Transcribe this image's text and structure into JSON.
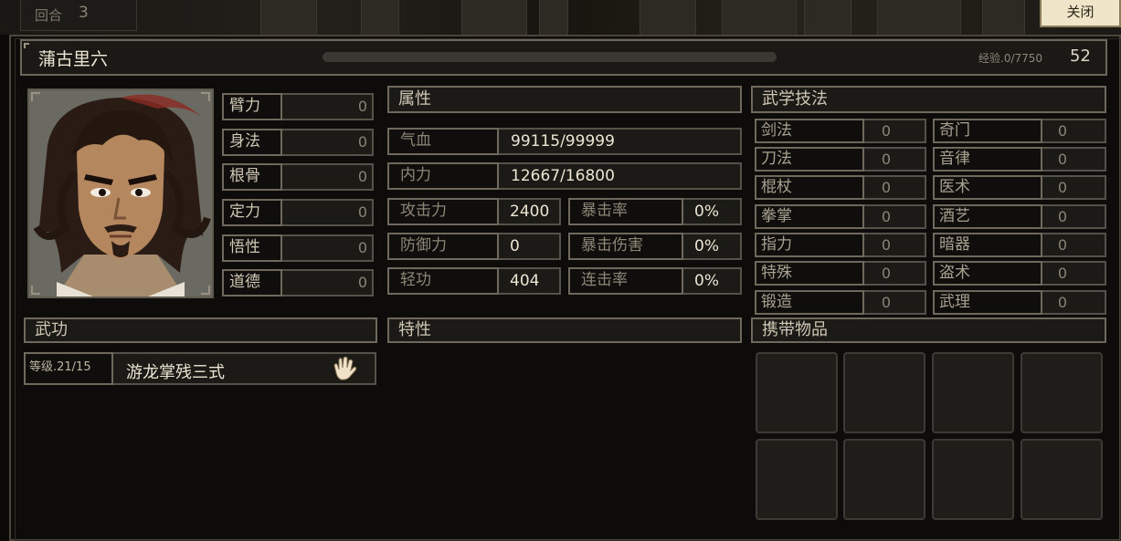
{
  "hud": {
    "round_label": "回合",
    "round_value": "3",
    "close_label": "关闭"
  },
  "character": {
    "name": "蒲古里六",
    "exp_label": "经验.0/7750",
    "exp_progress": 0,
    "level": "52"
  },
  "base_stats": [
    {
      "label": "臂力",
      "value": "0"
    },
    {
      "label": "身法",
      "value": "0"
    },
    {
      "label": "根骨",
      "value": "0"
    },
    {
      "label": "定力",
      "value": "0"
    },
    {
      "label": "悟性",
      "value": "0"
    },
    {
      "label": "道德",
      "value": "0"
    }
  ],
  "attributes": {
    "header": "属性",
    "hp_label": "气血",
    "hp_value": "99115/99999",
    "mp_label": "内力",
    "mp_value": "12667/16800",
    "atk_label": "攻击力",
    "atk_value": "2400",
    "crit_label": "暴击率",
    "crit_value": "0%",
    "def_label": "防御力",
    "def_value": "0",
    "critdmg_label": "暴击伤害",
    "critdmg_value": "0%",
    "agi_label": "轻功",
    "agi_value": "404",
    "combo_label": "连击率",
    "combo_value": "0%"
  },
  "martial_skills": {
    "header": "武学技法",
    "left": [
      {
        "label": "剑法",
        "value": "0"
      },
      {
        "label": "刀法",
        "value": "0"
      },
      {
        "label": "棍杖",
        "value": "0"
      },
      {
        "label": "拳掌",
        "value": "0"
      },
      {
        "label": "指力",
        "value": "0"
      },
      {
        "label": "特殊",
        "value": "0"
      },
      {
        "label": "锻造",
        "value": "0"
      }
    ],
    "right": [
      {
        "label": "奇门",
        "value": "0"
      },
      {
        "label": "音律",
        "value": "0"
      },
      {
        "label": "医术",
        "value": "0"
      },
      {
        "label": "酒艺",
        "value": "0"
      },
      {
        "label": "暗器",
        "value": "0"
      },
      {
        "label": "盗术",
        "value": "0"
      },
      {
        "label": "武理",
        "value": "0"
      }
    ]
  },
  "kungfu": {
    "header": "武功",
    "level_label": "等级.21/15",
    "name": "游龙掌残三式",
    "icon": "palm-icon"
  },
  "traits": {
    "header": "特性"
  },
  "items": {
    "header": "携带物品"
  },
  "colors": {
    "panel_border": "#6e695c",
    "text_main": "#ece5d3",
    "close_bg": "#efe5c8"
  }
}
